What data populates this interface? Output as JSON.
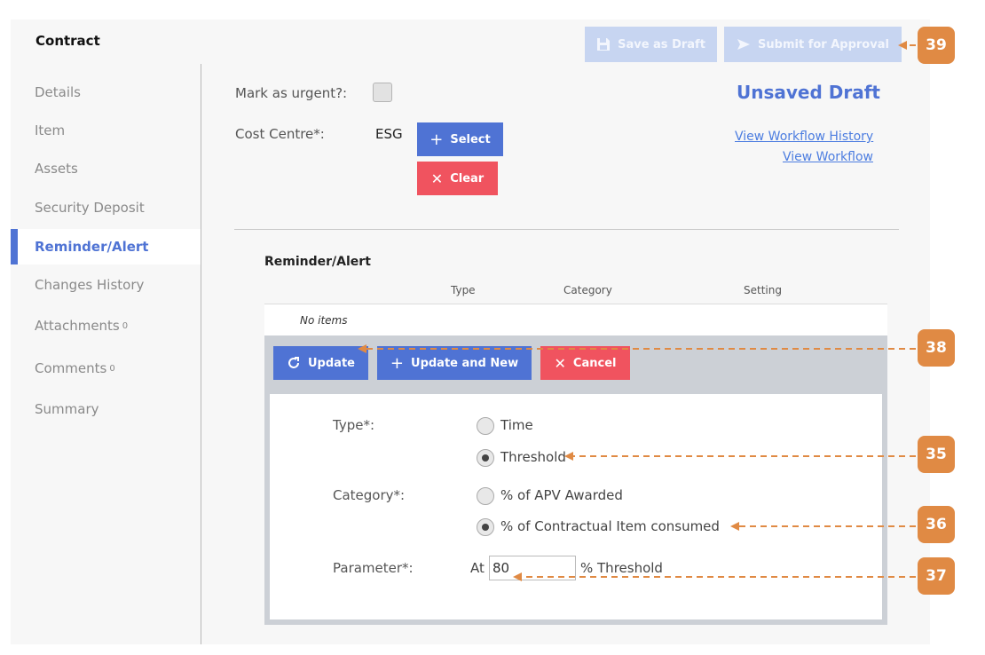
{
  "app": {
    "title": "Contract"
  },
  "toolbar": {
    "save_draft_label": "Save as Draft",
    "submit_label": "Submit for Approval"
  },
  "sidebar": {
    "items": [
      {
        "label": "Details",
        "badge": ""
      },
      {
        "label": "Item",
        "badge": ""
      },
      {
        "label": "Assets",
        "badge": ""
      },
      {
        "label": "Security Deposit",
        "badge": ""
      },
      {
        "label": "Reminder/Alert",
        "badge": "",
        "active": true
      },
      {
        "label": "Changes History",
        "badge": ""
      },
      {
        "label": "Attachments",
        "badge": "0"
      },
      {
        "label": "Comments",
        "badge": "0"
      },
      {
        "label": "Summary",
        "badge": ""
      }
    ]
  },
  "header": {
    "urgent_label": "Mark as urgent?:",
    "cost_centre_label": "Cost Centre*:",
    "cost_centre_value": "ESG",
    "select_label": "Select",
    "clear_label": "Clear",
    "status": "Unsaved Draft",
    "view_history_link": "View Workflow History",
    "view_workflow_link": "View Workflow"
  },
  "reminder": {
    "title": "Reminder/Alert",
    "columns": [
      "Type",
      "Category",
      "Setting"
    ],
    "empty_text": "No items",
    "update_label": "Update",
    "update_new_label": "Update and New",
    "cancel_label": "Cancel",
    "type_label": "Type*:",
    "type_options": [
      "Time",
      "Threshold"
    ],
    "type_selected": "Threshold",
    "category_label": "Category*:",
    "category_options": [
      "% of APV Awarded",
      "% of Contractual Item consumed"
    ],
    "category_selected": "% of Contractual Item consumed",
    "parameter_label": "Parameter*:",
    "parameter_prefix": "At",
    "parameter_value": "80",
    "parameter_suffix": "% Threshold"
  },
  "callouts": [
    "39",
    "38",
    "35",
    "36",
    "37"
  ],
  "colors": {
    "primary": "#4f73d4",
    "danger": "#f0535f",
    "callout": "#e08a44",
    "link": "#4c7de0",
    "disabled": "#c7d5f1"
  }
}
